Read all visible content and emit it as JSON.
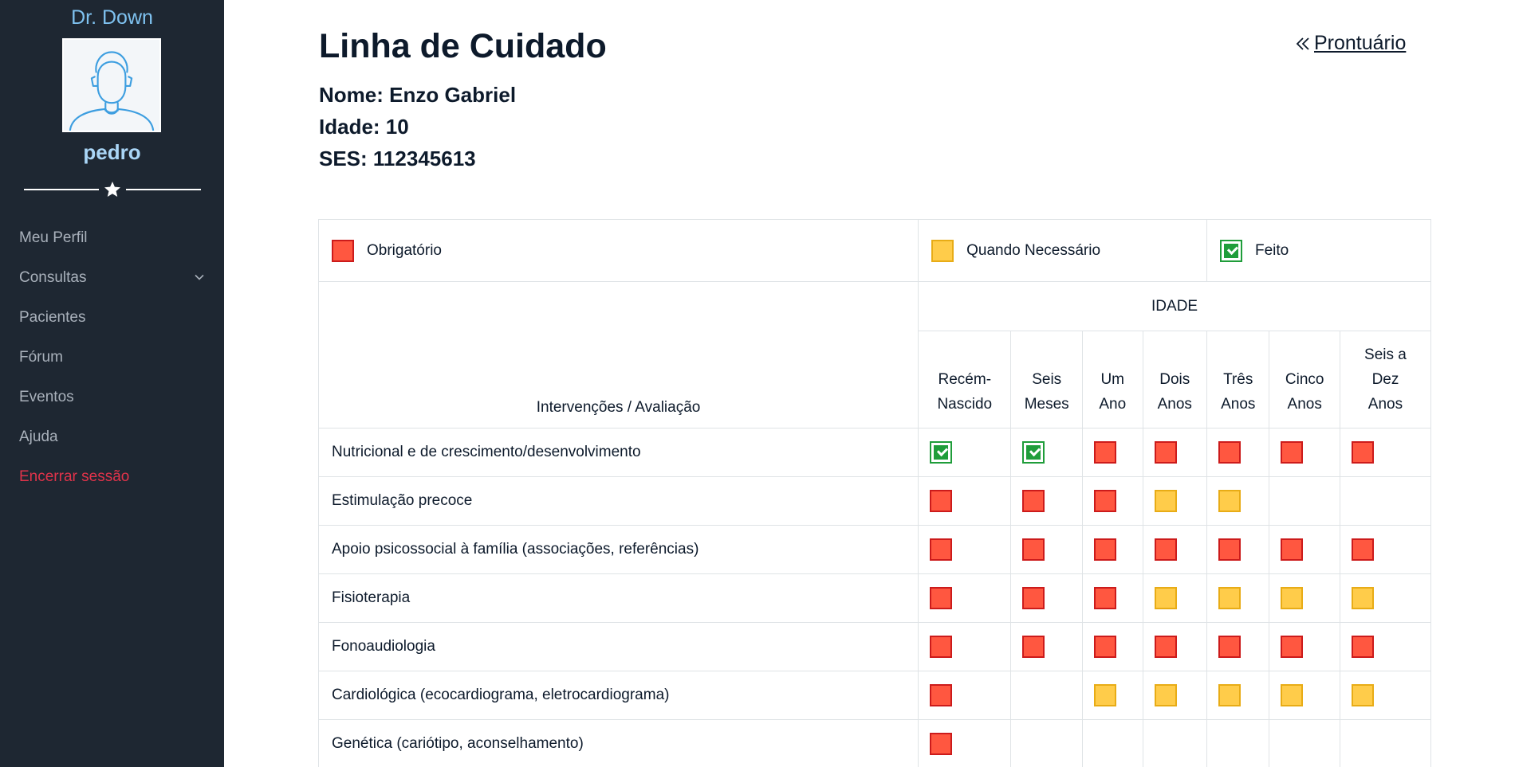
{
  "sidebar": {
    "brand": "Dr. Down",
    "username": "pedro",
    "items": [
      {
        "label": "Meu Perfil"
      },
      {
        "label": "Consultas",
        "has_submenu": true
      },
      {
        "label": "Pacientes"
      },
      {
        "label": "Fórum"
      },
      {
        "label": "Eventos"
      },
      {
        "label": "Ajuda"
      },
      {
        "label": "Encerrar sessão",
        "style": "logout"
      }
    ]
  },
  "header": {
    "title": "Linha de Cuidado",
    "back_link": "Prontuário"
  },
  "patient": {
    "name_line": "Nome: Enzo Gabriel",
    "age_line": "Idade: 10",
    "ses_line": "SES: 112345613"
  },
  "legend": {
    "required": "Obrigatório",
    "when_needed": "Quando Necessário",
    "done": "Feito"
  },
  "table": {
    "group_header": "IDADE",
    "first_col_header": "Intervenções / Avaliação",
    "age_columns": [
      {
        "l1": "Recém-",
        "l2": "Nascido"
      },
      {
        "l1": "Seis",
        "l2": "Meses"
      },
      {
        "l1": "Um",
        "l2": "Ano"
      },
      {
        "l1": "Dois",
        "l2": "Anos"
      },
      {
        "l1": "Três",
        "l2": "Anos"
      },
      {
        "l1": "Cinco",
        "l2": "Anos"
      },
      {
        "l0": "Seis a",
        "l1": "Dez",
        "l2": "Anos"
      }
    ],
    "rows": [
      {
        "label": "Nutricional e de crescimento/desenvolvimento",
        "status": [
          "done",
          "done",
          "required",
          "required",
          "required",
          "required",
          "required"
        ]
      },
      {
        "label": "Estimulação precoce",
        "status": [
          "required",
          "required",
          "required",
          "when_needed",
          "when_needed",
          "",
          ""
        ]
      },
      {
        "label": "Apoio psicossocial à família (associações, referências)",
        "status": [
          "required",
          "required",
          "required",
          "required",
          "required",
          "required",
          "required"
        ]
      },
      {
        "label": "Fisioterapia",
        "status": [
          "required",
          "required",
          "required",
          "when_needed",
          "when_needed",
          "when_needed",
          "when_needed"
        ]
      },
      {
        "label": "Fonoaudiologia",
        "status": [
          "required",
          "required",
          "required",
          "required",
          "required",
          "required",
          "required"
        ]
      },
      {
        "label": "Cardiológica (ecocardiograma, eletrocardiograma)",
        "status": [
          "required",
          "",
          "when_needed",
          "when_needed",
          "when_needed",
          "when_needed",
          "when_needed"
        ]
      },
      {
        "label": "Genética (cariótipo, aconselhamento)",
        "status": [
          "required",
          "",
          "",
          "",
          "",
          "",
          ""
        ]
      }
    ]
  },
  "colors": {
    "sidebar_bg": "#1e2732",
    "brand": "#7fc2f0",
    "logout": "#e0334a",
    "required_fill": "#ff5740",
    "when_needed_fill": "#ffcc4a",
    "done": "#1f9d3a"
  }
}
